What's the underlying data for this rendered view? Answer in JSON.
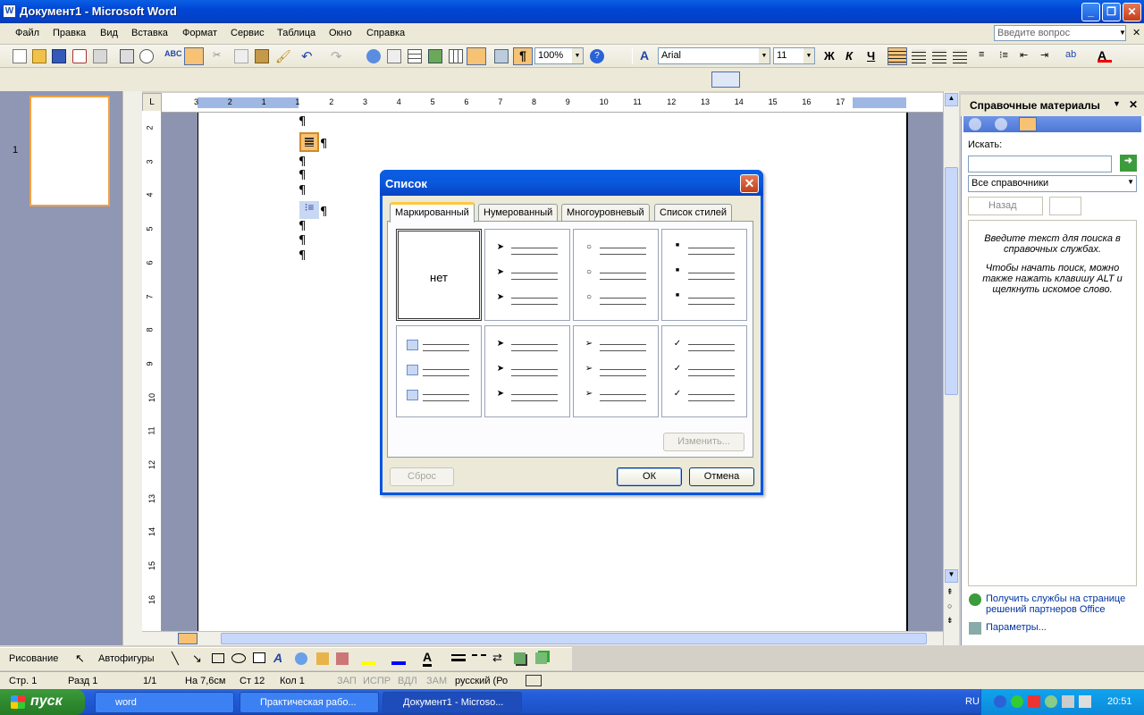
{
  "window": {
    "title": "Документ1 - Microsoft Word",
    "app_icon": "W"
  },
  "menu": {
    "items": [
      "Файл",
      "Правка",
      "Вид",
      "Вставка",
      "Формат",
      "Сервис",
      "Таблица",
      "Окно",
      "Справка"
    ],
    "ask_placeholder": "Введите вопрос"
  },
  "toolbar": {
    "zoom": "100%",
    "font": "Arial",
    "size": "11",
    "bold": "Ж",
    "italic": "К",
    "underline": "Ч"
  },
  "ruler": {
    "h_ticks": [
      "3",
      "2",
      "1",
      "1",
      "2",
      "3",
      "4",
      "5",
      "6",
      "7",
      "8",
      "9",
      "10",
      "11",
      "12",
      "13",
      "14",
      "15",
      "16",
      "17"
    ],
    "v_ticks": [
      "2",
      "3",
      "4",
      "5",
      "6",
      "7",
      "8",
      "9",
      "10",
      "11",
      "12",
      "13",
      "14",
      "15",
      "16"
    ]
  },
  "thumb": {
    "page_number": "1"
  },
  "doc": {
    "pilcrow": "¶"
  },
  "dialog": {
    "title": "Список",
    "tabs": [
      "Маркированный",
      "Нумерованный",
      "Многоуровневый",
      "Список стилей"
    ],
    "none_label": "нет",
    "change_btn": "Изменить...",
    "reset_btn": "Сброс",
    "ok_btn": "ОК",
    "cancel_btn": "Отмена",
    "styles": [
      "none",
      "arrow",
      "circle",
      "square",
      "picture",
      "arrow",
      "arrow-small",
      "check"
    ]
  },
  "taskpane": {
    "title": "Справочные материалы",
    "search_label": "Искать:",
    "search_value": "",
    "source": "Все справочники",
    "back_btn": "Назад",
    "hint1": "Введите текст для поиска в справочных службах.",
    "hint2": "Чтобы начать поиск, можно также нажать клавишу ALT и щелкнуть искомое слово.",
    "link1": "Получить службы на странице решений партнеров Office",
    "link2": "Параметры..."
  },
  "drawbar": {
    "draw": "Рисование",
    "autoshapes": "Автофигуры"
  },
  "status": {
    "page": "Стр. 1",
    "section": "Разд 1",
    "pages": "1/1",
    "at": "На 7,6см",
    "line": "Ст 12",
    "col": "Кол 1",
    "rec": "ЗАП",
    "trk": "ИСПР",
    "ext": "ВДЛ",
    "ovr": "ЗАМ",
    "lang": "русский (Ро"
  },
  "taskbar": {
    "start": "пуск",
    "tasks": [
      "word",
      "Практическая  рабо...",
      "Документ1 - Microso..."
    ],
    "lang": "RU",
    "time": "20:51"
  },
  "colors": {
    "title_blue": "#0a5fe4",
    "accent_orange": "#ffc83c",
    "highlight": "#f7c274"
  }
}
